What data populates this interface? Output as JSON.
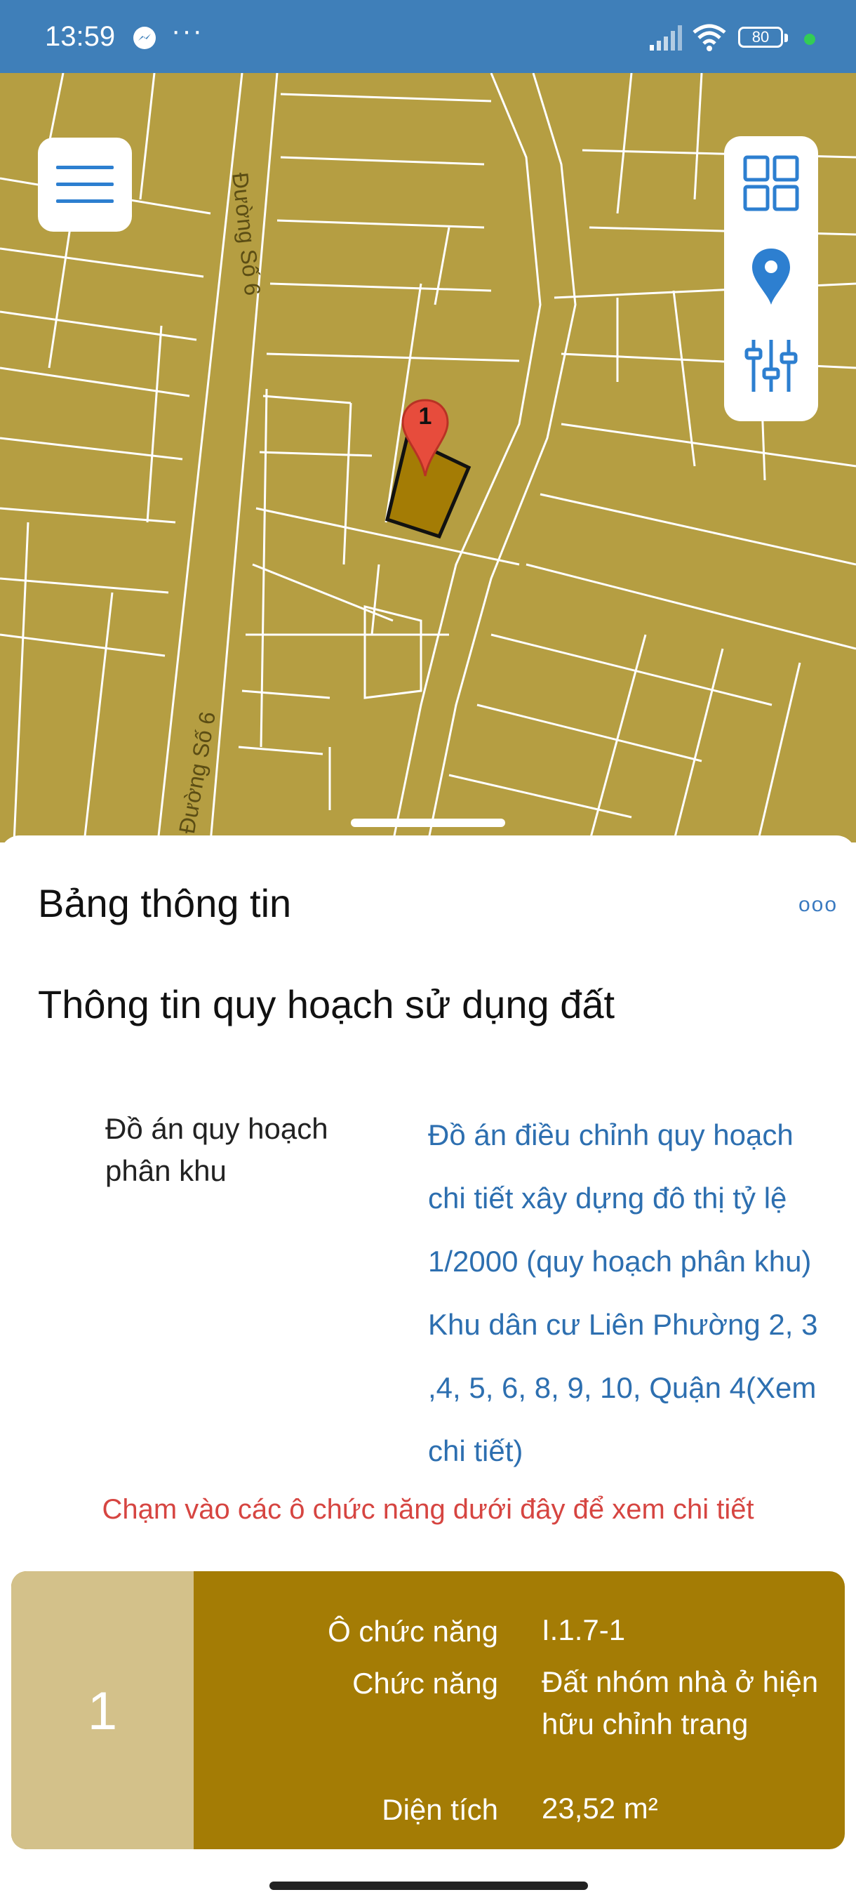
{
  "status_bar": {
    "time": "13:59",
    "more": "···",
    "battery": "80",
    "icons": [
      "messenger-icon",
      "signal-icon",
      "wifi-icon",
      "battery-icon"
    ]
  },
  "map": {
    "road_labels": [
      "Đường Số 6",
      "Đường Số 6"
    ],
    "marker_label": "1",
    "colors": {
      "land": "#b59e42",
      "lines": "#ffffff",
      "parcel": "#a47c05",
      "marker": "#e74c3c"
    }
  },
  "toolbar": {
    "icons": [
      "menu-icon",
      "grid-icon",
      "location-pin-icon",
      "sliders-icon"
    ]
  },
  "sheet": {
    "title": "Bảng thông tin",
    "more_label": "ooo",
    "section_title": "Thông tin quy hoạch sử dụng đất",
    "field_label": "Đồ án quy hoạch phân khu",
    "field_value": "Đồ án điều chỉnh quy hoạch\nchi tiết xây dựng đô thị tỷ lệ\n1/2000 (quy hoạch phân khu)\nKhu dân cư Liên Phường 2, 3\n,4, 5, 6, 8, 9, 10, Quận 4(Xem\nchi tiết)",
    "hint": "Chạm vào các ô chức năng dưới đây để xem chi tiết"
  },
  "card": {
    "number": "1",
    "rows": [
      {
        "label": "Ô chức năng",
        "value": "I.1.7-1"
      },
      {
        "label": "Chức năng",
        "value": "Đất nhóm nhà ở hiện hữu chỉnh trang"
      },
      {
        "label": "Diện tích",
        "value": "23,52 m²"
      }
    ],
    "colors": {
      "left": "#d3c18a",
      "right": "#a47c05"
    }
  }
}
